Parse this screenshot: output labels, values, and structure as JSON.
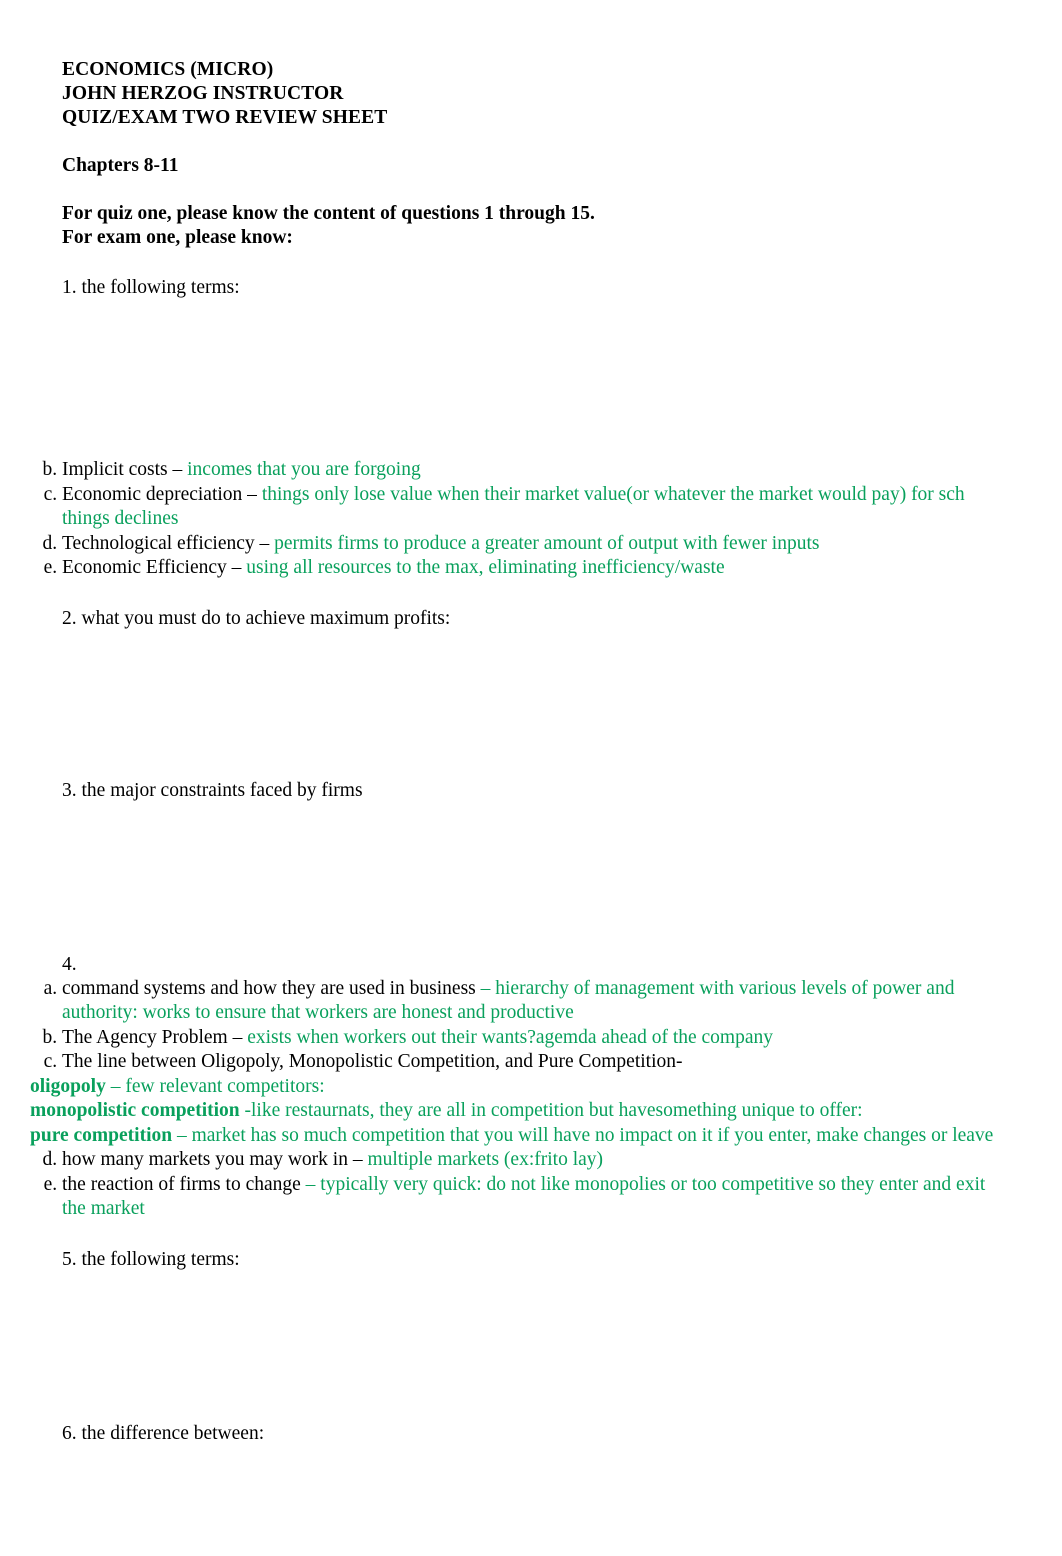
{
  "document": {
    "heading": {
      "line1": "ECONOMICS (MICRO)",
      "line2": "JOHN HERZOG INSTRUCTOR",
      "line3": "QUIZ/EXAM TWO REVIEW SHEET",
      "chapters": "Chapters 8-11",
      "quiz_note": "For quiz one, please know the content of questions 1 through 15.",
      "exam_note": "For exam one, please know:"
    },
    "sections": {
      "s1": {
        "prompt": "1. the following terms:",
        "items": {
          "b": {
            "term": "Implicit costs – ",
            "answer": "incomes that you are forgoing"
          },
          "c": {
            "term": "Economic depreciation – ",
            "answer": "things only lose value when their market value(or whatever the market would pay) for sch things declines"
          },
          "d": {
            "term": "Technological efficiency – ",
            "answer": "permits firms to produce a greater amount of output with fewer inputs"
          },
          "e": {
            "term": "Economic Efficiency – ",
            "answer": "using all resources to the max, eliminating inefficiency/waste"
          }
        }
      },
      "s2": {
        "prompt": "2. what you must do to achieve maximum profits:"
      },
      "s3": {
        "prompt": "3. the major constraints faced by firms"
      },
      "s4": {
        "prompt": "4.",
        "items": {
          "a": {
            "term": "command systems and how they are used in business ",
            "answer": "– hierarchy of management with various levels of power and authority: works to ensure that workers are honest and productive"
          },
          "b": {
            "term": "The Agency Problem – ",
            "answer": "exists when workers out their wants?agemda ahead of the company"
          },
          "c": {
            "term": "The line between Oligopoly, Monopolistic Competition, and Pure Competition-",
            "sub1_label": "oligopoly",
            "sub1_text": " – few relevant competitors:",
            "sub2_label": "monopolistic competition",
            "sub2_text": " -like restaurnats, they are all in competition but havesomething unique to offer:",
            "sub3_label": "pure competition",
            "sub3_text": " – market has so much competition that you will have no impact on it if you enter, make changes or leave"
          },
          "d": {
            "term": "how many markets you may work in – ",
            "answer": "multiple markets (ex:frito lay)"
          },
          "e": {
            "term": "the reaction of firms to change ",
            "answer": "– typically very quick: do not like monopolies or too competitive so they enter and exit the market"
          }
        }
      },
      "s5": {
        "prompt": "5. the following terms:"
      },
      "s6": {
        "prompt": "6. the difference between:"
      }
    },
    "colors": {
      "answer_green": "#09a05c",
      "text_black": "#000000",
      "page_background": "#ffffff"
    }
  }
}
